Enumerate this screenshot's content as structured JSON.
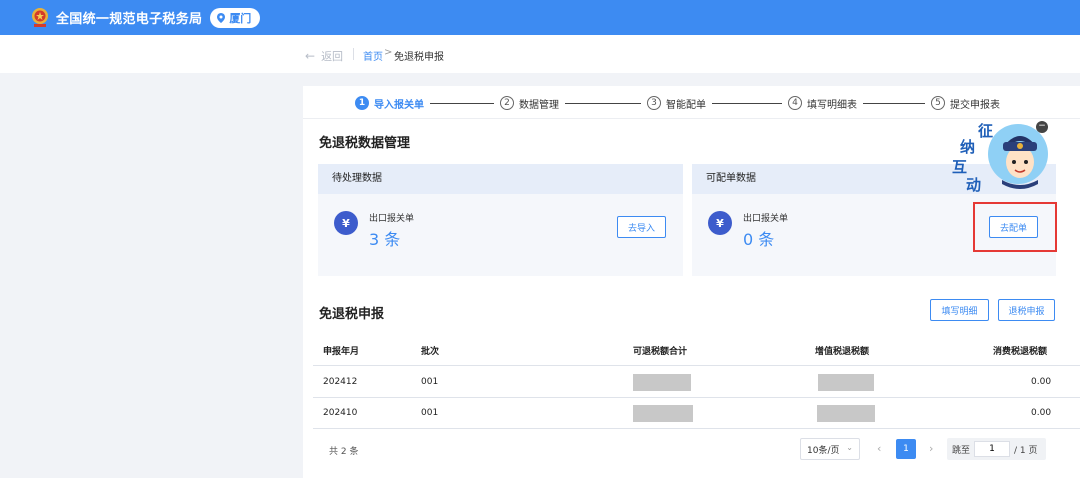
{
  "header": {
    "title": "全国统一规范电子税务局",
    "city": "厦门",
    "colors": {
      "brand": "#3d8bf2"
    }
  },
  "breadcrumb": {
    "back_label": "返回",
    "home": "首页",
    "separator": ">",
    "current": "免退税申报"
  },
  "steps": [
    {
      "num": "1",
      "label": "导入报关单",
      "active": true
    },
    {
      "num": "2",
      "label": "数据管理"
    },
    {
      "num": "3",
      "label": "智能配单"
    },
    {
      "num": "4",
      "label": "填写明细表"
    },
    {
      "num": "5",
      "label": "提交申报表"
    }
  ],
  "data_mgmt": {
    "title": "免退税数据管理",
    "pending": {
      "title": "待处理数据",
      "kind": "出口报关单",
      "count": "3 条",
      "button": "去导入"
    },
    "matchable": {
      "title": "可配单数据",
      "kind": "出口报关单",
      "count": "0 条",
      "button": "去配单"
    }
  },
  "mascot": {
    "text": [
      "征",
      "纳",
      "互",
      "动"
    ],
    "close": "−"
  },
  "declaration": {
    "title": "免退税申报",
    "fill_button": "填写明细",
    "return_button": "退税申报",
    "columns": [
      "申报年月",
      "批次",
      "可退税额合计",
      "增值税退税额",
      "消费税退税额"
    ],
    "rows": [
      {
        "period": "202412",
        "batch": "001",
        "consumption_refund": "0.00"
      },
      {
        "period": "202410",
        "batch": "001",
        "consumption_refund": "0.00"
      }
    ]
  },
  "pagination": {
    "total": "共 2 条",
    "page_size": "10条/页",
    "prev": "‹",
    "next": "›",
    "current_page": "1",
    "jump_label": "跳至",
    "jump_value": "1",
    "pages_label": "/ 1 页"
  }
}
